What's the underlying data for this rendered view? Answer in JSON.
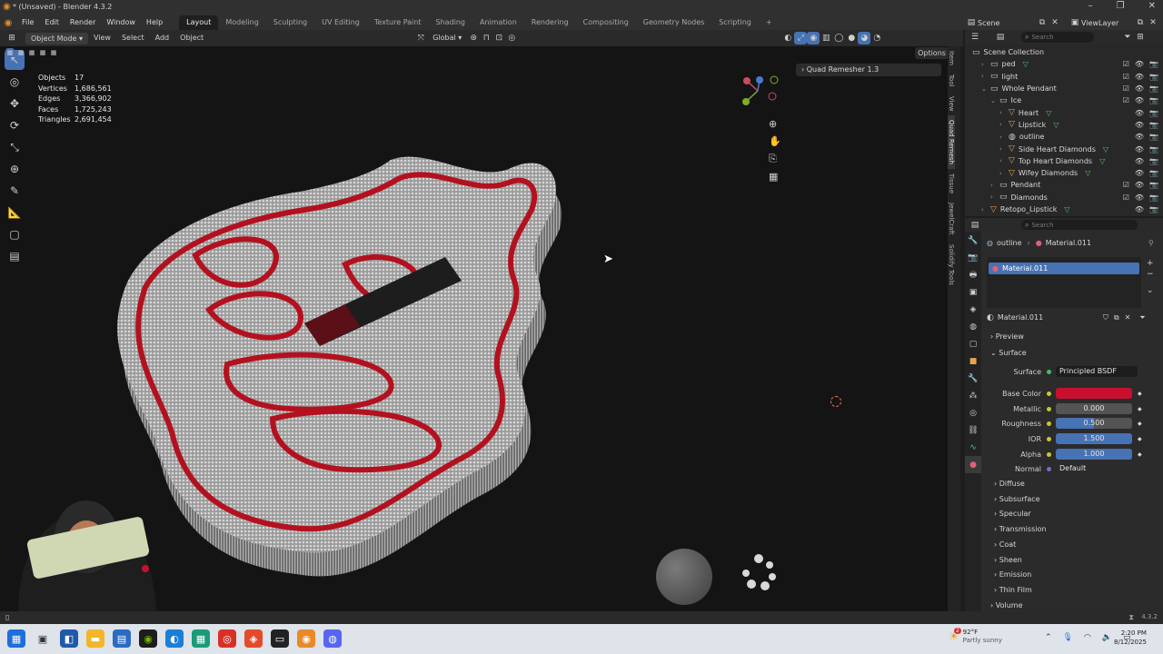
{
  "window": {
    "title": "* (Unsaved) - Blender 4.3.2"
  },
  "menu": {
    "items": [
      "File",
      "Edit",
      "Render",
      "Window",
      "Help"
    ],
    "workspaces": [
      "Layout",
      "Modeling",
      "Sculpting",
      "UV Editing",
      "Texture Paint",
      "Shading",
      "Animation",
      "Rendering",
      "Compositing",
      "Geometry Nodes",
      "Scripting"
    ],
    "add_tab": "+",
    "scene": "Scene",
    "view_layer": "ViewLayer"
  },
  "viewport_header": {
    "mode": "Object Mode",
    "menus": [
      "View",
      "Select",
      "Add",
      "Object"
    ],
    "transform": "Global"
  },
  "stats": [
    {
      "label": "Objects",
      "value": "17"
    },
    {
      "label": "Vertices",
      "value": "1,686,561"
    },
    {
      "label": "Edges",
      "value": "3,366,902"
    },
    {
      "label": "Faces",
      "value": "1,725,243"
    },
    {
      "label": "Triangles",
      "value": "2,691,454"
    }
  ],
  "options_label": "Options",
  "operator_panel": "Quad Remesher 1.3",
  "sidebar_tabs": [
    "Item",
    "Tool",
    "View",
    "Quad Remesh",
    "Tissue",
    "JewelCraft",
    "Solidify Tools"
  ],
  "outliner": {
    "search_placeholder": "Search",
    "rows": [
      {
        "label": "Scene Collection",
        "indent": 0,
        "kind": "root"
      },
      {
        "label": "ped",
        "indent": 1,
        "kind": "collection"
      },
      {
        "label": "light",
        "indent": 1,
        "kind": "collection"
      },
      {
        "label": "Whole Pendant",
        "indent": 1,
        "kind": "collection"
      },
      {
        "label": "Ice",
        "indent": 2,
        "kind": "collection"
      },
      {
        "label": "Heart",
        "indent": 3,
        "kind": "object"
      },
      {
        "label": "Lipstick",
        "indent": 3,
        "kind": "object"
      },
      {
        "label": "outline",
        "indent": 3,
        "kind": "curve"
      },
      {
        "label": "Side Heart Diamonds",
        "indent": 3,
        "kind": "object"
      },
      {
        "label": "Top Heart Diamonds",
        "indent": 3,
        "kind": "object"
      },
      {
        "label": "Wifey Diamonds",
        "indent": 3,
        "kind": "object"
      },
      {
        "label": "Pendant",
        "indent": 2,
        "kind": "collection"
      },
      {
        "label": "Diamonds",
        "indent": 2,
        "kind": "collection"
      },
      {
        "label": "Retopo_Lipstick",
        "indent": 1,
        "kind": "object"
      }
    ]
  },
  "properties": {
    "search_placeholder": "Search",
    "breadcrumb_object": "outline",
    "breadcrumb_material": "Material.011",
    "slot": "Material.011",
    "material_name": "Material.011",
    "panels": {
      "preview": "Preview",
      "surface": "Surface"
    },
    "surface_label": "Surface",
    "surface_value": "Principled BSDF",
    "base_color_label": "Base Color",
    "base_color": "#c8102e",
    "fields": [
      {
        "label": "Metallic",
        "value": "0.000",
        "fill": 0.0
      },
      {
        "label": "Roughness",
        "value": "0.500",
        "fill": 0.5
      },
      {
        "label": "IOR",
        "value": "1.500",
        "fill": 1.0
      },
      {
        "label": "Alpha",
        "value": "1.000",
        "fill": 1.0
      }
    ],
    "normal_label": "Normal",
    "normal_value": "Default",
    "subpanels": [
      "Diffuse",
      "Subsurface",
      "Specular",
      "Transmission",
      "Coat",
      "Sheen",
      "Emission",
      "Thin Film",
      "Volume"
    ]
  },
  "status": {
    "version": "4.3.2"
  },
  "taskbar": {
    "weather_temp": "92°F",
    "weather_desc": "Partly sunny",
    "time": "2:20 PM",
    "date": "8/12/2025",
    "weather_badge": "2"
  },
  "colors": {
    "accent": "#4772b3",
    "pendant_red": "#c8102e"
  }
}
